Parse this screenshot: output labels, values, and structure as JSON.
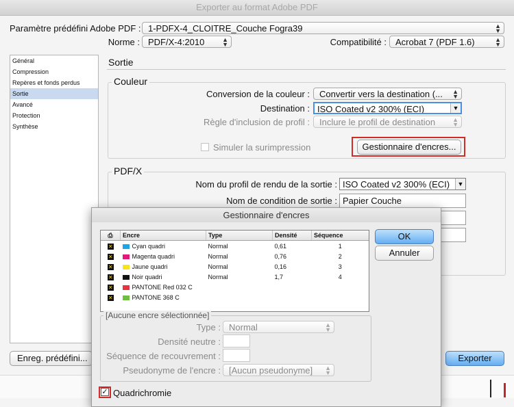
{
  "window": {
    "title": "Exporter au format Adobe PDF"
  },
  "preset": {
    "label": "Paramètre prédéfini Adobe PDF :",
    "value": "1-PDFX-4_CLOITRE_Couche Fogra39"
  },
  "norme": {
    "label": "Norme :",
    "value": "PDF/X-4:2010"
  },
  "compat": {
    "label": "Compatibilité :",
    "value": "Acrobat 7 (PDF 1.6)"
  },
  "nav": {
    "items": [
      "Général",
      "Compression",
      "Repères et fonds perdus",
      "Sortie",
      "Avancé",
      "Protection",
      "Synthèse"
    ],
    "selected_index": 3
  },
  "section_title": "Sortie",
  "couleur": {
    "title": "Couleur",
    "conversion_label": "Conversion de la couleur :",
    "conversion_value": "Convertir vers la destination (...",
    "destination_label": "Destination :",
    "destination_value": "ISO Coated v2 300% (ECI)",
    "inclusion_label": "Règle d'inclusion de profil :",
    "inclusion_value": "Inclure le profil de destination",
    "simulate_label": "Simuler la surimpression",
    "ink_manager_button": "Gestionnaire d'encres..."
  },
  "pdfx": {
    "title": "PDF/X",
    "profile_label": "Nom du profil de rendu de la sortie :",
    "profile_value": "ISO Coated v2 300% (ECI)",
    "condition_label": "Nom de condition de sortie :",
    "condition_value": "Papier Couche"
  },
  "bottom": {
    "save_preset": "Enreg. prédéfini...",
    "export": "Exporter"
  },
  "ink_manager": {
    "title": "Gestionnaire d'encres",
    "headers": [
      "Encre",
      "Type",
      "Densité",
      "Séquence"
    ],
    "rows": [
      {
        "name": "Cyan quadri",
        "color": "#1aa7e6",
        "type": "Normal",
        "density": "0,61",
        "sequence": "1"
      },
      {
        "name": "Magenta quadri",
        "color": "#e2197a",
        "type": "Normal",
        "density": "0,76",
        "sequence": "2"
      },
      {
        "name": "Jaune quadri",
        "color": "#f7e51a",
        "type": "Normal",
        "density": "0,16",
        "sequence": "3"
      },
      {
        "name": "Noir quadri",
        "color": "#111111",
        "type": "Normal",
        "density": "1,7",
        "sequence": "4"
      },
      {
        "name": "PANTONE Red 032 C",
        "color": "#e5333f",
        "type": "",
        "density": "",
        "sequence": ""
      },
      {
        "name": "PANTONE 368 C",
        "color": "#6fbe44",
        "type": "",
        "density": "",
        "sequence": ""
      }
    ],
    "ok": "OK",
    "cancel": "Annuler",
    "group_title": "[Aucune encre sélectionnée]",
    "type_label": "Type :",
    "type_value": "Normal",
    "density_label": "Densité neutre :",
    "trap_label": "Séquence de recouvrement :",
    "alias_label": "Pseudonyme de l'encre :",
    "alias_value": "[Aucun pseudonyme]",
    "process_label": "Quadrichromie"
  }
}
